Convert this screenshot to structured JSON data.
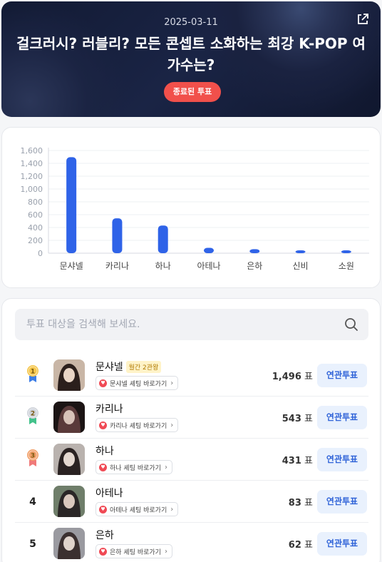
{
  "hero": {
    "date": "2025-03-11",
    "title": "걸크러시? 러블리? 모든 콘셉트 소화하는 최강 K-POP 여가수는?",
    "status_badge": "종료된 투표"
  },
  "chart_data": {
    "type": "bar",
    "categories": [
      "문샤넬",
      "카리나",
      "하나",
      "아테나",
      "은하",
      "신비",
      "소원"
    ],
    "values": [
      1496,
      543,
      431,
      83,
      62,
      40,
      38
    ],
    "yticks": [
      0,
      200,
      400,
      600,
      800,
      1000,
      1200,
      1400,
      1600
    ],
    "ytick_labels": [
      "0",
      "200",
      "400",
      "600",
      "800",
      "1,000",
      "1,200",
      "1,400",
      "1,600"
    ],
    "ylim": [
      0,
      1600
    ],
    "color": "#2f63e8",
    "grid": true
  },
  "search": {
    "placeholder": "투표 대상을 검색해 보세요."
  },
  "candidates": [
    {
      "rank": "1",
      "medal": "gold-medal-icon",
      "name": "문샤넬",
      "tag": "월간 2관왕",
      "fan_link": "문샤넬 셰팅 바로가기",
      "votes": "1,496",
      "unit": "표",
      "button": "연관투표"
    },
    {
      "rank": "2",
      "medal": "silver-medal-icon",
      "name": "카리나",
      "tag": "",
      "fan_link": "카리나 셰팅 바로가기",
      "votes": "543",
      "unit": "표",
      "button": "연관투표"
    },
    {
      "rank": "3",
      "medal": "bronze-medal-icon",
      "name": "하나",
      "tag": "",
      "fan_link": "하나 셰팅 바로가기",
      "votes": "431",
      "unit": "표",
      "button": "연관투표"
    },
    {
      "rank": "4",
      "medal": "",
      "name": "아테나",
      "tag": "",
      "fan_link": "아테나 셰팅 바로가기",
      "votes": "83",
      "unit": "표",
      "button": "연관투표"
    },
    {
      "rank": "5",
      "medal": "",
      "name": "은하",
      "tag": "",
      "fan_link": "은하 셰팅 바로가기",
      "votes": "62",
      "unit": "표",
      "button": "연관투표"
    }
  ],
  "colors": {
    "accent": "#2f63e8",
    "badge": "#f1504b",
    "gold": "#f5c64a",
    "silver": "#cfd3da",
    "bronze": "#f1a06a"
  }
}
